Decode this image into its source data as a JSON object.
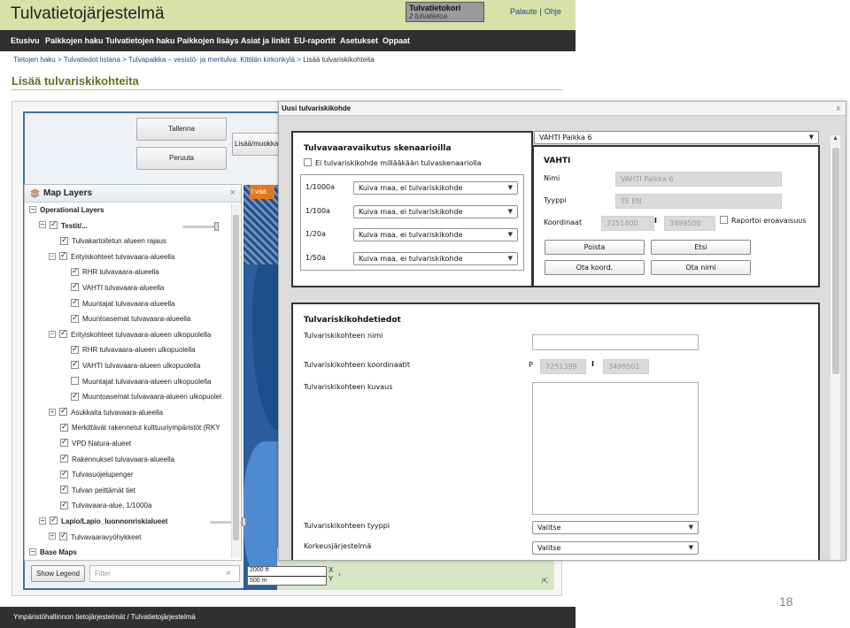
{
  "app": {
    "title": "Tulvatietojärjestelmä",
    "basket_title": "Tulvatietokori",
    "basket_sub": "2 tulvatietoa",
    "link_feedback": "Palaute",
    "link_sep": "|",
    "link_help": "Ohje"
  },
  "nav": [
    "Etusivu",
    "Paikkojen haku",
    "Tulvatietojen haku",
    "Paikkojen lisäys",
    "Asiat ja linkit",
    "EU-raportit",
    "Asetukset",
    "Oppaat"
  ],
  "breadcrumb": {
    "items": [
      "Tietojen haku",
      "Tulvatiedot listana",
      "Tulvapaikka – vesistö- ja meritulva: Kittilän kirkonkylä"
    ],
    "sep": " > ",
    "current": "Lisää tulvariskikohteita"
  },
  "page_title": "Lisää tulvariskikohteita",
  "map_app": {
    "save_label": "Tallenna",
    "cancel_label": "Peruuta",
    "add_edit_label": "Lisää/muokka",
    "map_tag": "l vaa",
    "layers_title": "Map Layers",
    "show_legend": "Show Legend",
    "filter_placeholder": "Filter",
    "scale_ft": "2000 ft",
    "scale_m": "500 m",
    "coord_x": "X",
    "coord_y": "Y",
    "layers": [
      {
        "label": "Operational Layers",
        "toggle": "−",
        "checked": null,
        "bold": true
      },
      {
        "label": "Testit/...",
        "toggle": "−",
        "checked": true,
        "bold": true
      },
      {
        "label": "Tulvakartoitetun alueen rajaus",
        "toggle": null,
        "checked": true,
        "bold": false
      },
      {
        "label": "Erityiskohteet tulvavaara-alueella",
        "toggle": "−",
        "checked": true,
        "bold": false
      },
      {
        "label": "RHR tulvavaara-alueella",
        "toggle": null,
        "checked": true,
        "bold": false
      },
      {
        "label": "VAHTI tulvavaara-alueella",
        "toggle": null,
        "checked": true,
        "bold": false
      },
      {
        "label": "Muuntajat tulvavaara-alueella",
        "toggle": null,
        "checked": true,
        "bold": false
      },
      {
        "label": "Muuntoasemat tulvavaara-alueella",
        "toggle": null,
        "checked": true,
        "bold": false
      },
      {
        "label": "Erityiskohteet tulvavaara-alueen ulkopuolella",
        "toggle": "−",
        "checked": true,
        "bold": false
      },
      {
        "label": "RHR tulvavaara-alueen ulkopuolella",
        "toggle": null,
        "checked": true,
        "bold": false
      },
      {
        "label": "VAHTI tulvavaara-alueen ulkopuolella",
        "toggle": null,
        "checked": true,
        "bold": false
      },
      {
        "label": "Muuntajat tulvavaara-alueen ulkopuolella",
        "toggle": null,
        "checked": false,
        "bold": false
      },
      {
        "label": "Muuntoasemat tulvavaara-alueen ulkopuolel",
        "toggle": null,
        "checked": true,
        "bold": false
      },
      {
        "label": "Asukkaita tulvavaara-alueella",
        "toggle": "+",
        "checked": true,
        "bold": false
      },
      {
        "label": "Merkittävät rakennetut kulttuuriympäristöt (RKY",
        "toggle": null,
        "checked": true,
        "bold": false
      },
      {
        "label": "VPD Natura-alueet",
        "toggle": null,
        "checked": true,
        "bold": false
      },
      {
        "label": "Rakennukset tulvavaara-alueella",
        "toggle": null,
        "checked": true,
        "bold": false
      },
      {
        "label": "Tulvasuojelupenger",
        "toggle": null,
        "checked": true,
        "bold": false
      },
      {
        "label": "Tulvan peittämät tiet",
        "toggle": null,
        "checked": true,
        "bold": false
      },
      {
        "label": "Tulvavaara-alue, 1/1000a",
        "toggle": null,
        "checked": true,
        "bold": false
      },
      {
        "label": "Lapio/Lapio_luonnonriskialueet",
        "toggle": "−",
        "checked": true,
        "bold": true
      },
      {
        "label": "Tulvavaaravyöhykkeet",
        "toggle": "+",
        "checked": true,
        "bold": false
      },
      {
        "label": "Base Maps",
        "toggle": "−",
        "checked": null,
        "bold": true
      }
    ]
  },
  "footer": "Ympäristöhallinnon tietojärjestelmät / Tulvatietojärjestelmä",
  "slide_number": "18",
  "dialog": {
    "title": "Uusi tulvariskikohde",
    "close": "x",
    "scenario": {
      "title": "Tulvavaaravaikutus skenaarioilla",
      "none_label": "Ei tulvariskikohde millääkään tulvaskenaariolla",
      "none_checked": false,
      "rows": [
        {
          "label": "1/1000a",
          "value": "Kuiva maa, ei tulvariskikohde"
        },
        {
          "label": "1/100a",
          "value": "Kuiva maa, ei tulvariskikohde"
        },
        {
          "label": "1/20a",
          "value": "Kuiva maa, ei tulvariskikohde"
        },
        {
          "label": "1/50a",
          "value": "Kuiva maa, ei tulvariskikohde"
        }
      ]
    },
    "place": {
      "select_value": "VAHTI Paikka 6",
      "header": "VAHTI",
      "name_label": "Nimi",
      "name_value": "VAHTI Paikka 6",
      "type_label": "Tyyppi",
      "type_value": "TE EN",
      "coords_label": "Koordinaat",
      "p_label": "P",
      "p_value": "7251400",
      "i_label": "I",
      "i_value": "3499500",
      "report_label": "Raportoi eroavaisuus",
      "report_checked": false,
      "btn_delete": "Poista",
      "btn_search": "Etsi",
      "btn_take_coords": "Ota koord.",
      "btn_take_name": "Ota nimi"
    },
    "details": {
      "title": "Tulvariskikohdetiedot",
      "name_label": "Tulvariskikohteen nimi",
      "name_value": "",
      "coords_label": "Tulvariskikohteen koordinaatit",
      "p_label": "P",
      "p_value": "7251399",
      "i_label": "I",
      "i_value": "3499501",
      "desc_label": "Tulvariskikohteen kuvaus",
      "desc_value": "",
      "type_label": "Tulvariskikohteen tyyppi",
      "type_value": "Valitse",
      "height_label": "Korkeusjärjestelmä",
      "height_value": "Valitse"
    }
  }
}
